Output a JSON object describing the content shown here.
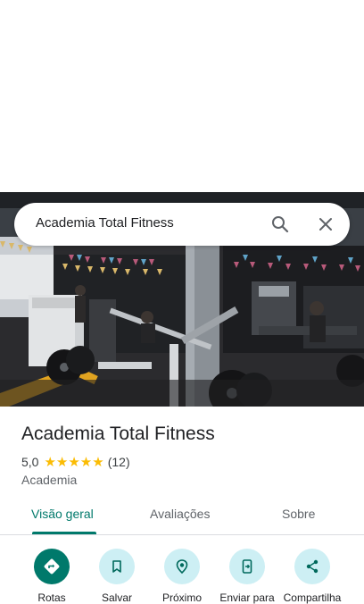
{
  "search": {
    "query": "Academia Total Fitness"
  },
  "place": {
    "title": "Academia Total Fitness",
    "rating": "5,0",
    "stars": "★★★★★",
    "review_count": "(12)",
    "category": "Academia"
  },
  "tabs": [
    {
      "label": "Visão geral",
      "active": true
    },
    {
      "label": "Avaliações",
      "active": false
    },
    {
      "label": "Sobre",
      "active": false
    }
  ],
  "actions": [
    {
      "label": "Rotas",
      "icon": "directions-icon"
    },
    {
      "label": "Salvar",
      "icon": "bookmark-icon"
    },
    {
      "label": "Próximo",
      "icon": "nearby-icon"
    },
    {
      "label": "Enviar para",
      "icon": "send-to-phone-icon"
    },
    {
      "label": "Compartilha",
      "icon": "share-icon"
    }
  ],
  "colors": {
    "accent": "#00796b",
    "action_bg": "#cdeff4",
    "star": "#fbbc04"
  }
}
